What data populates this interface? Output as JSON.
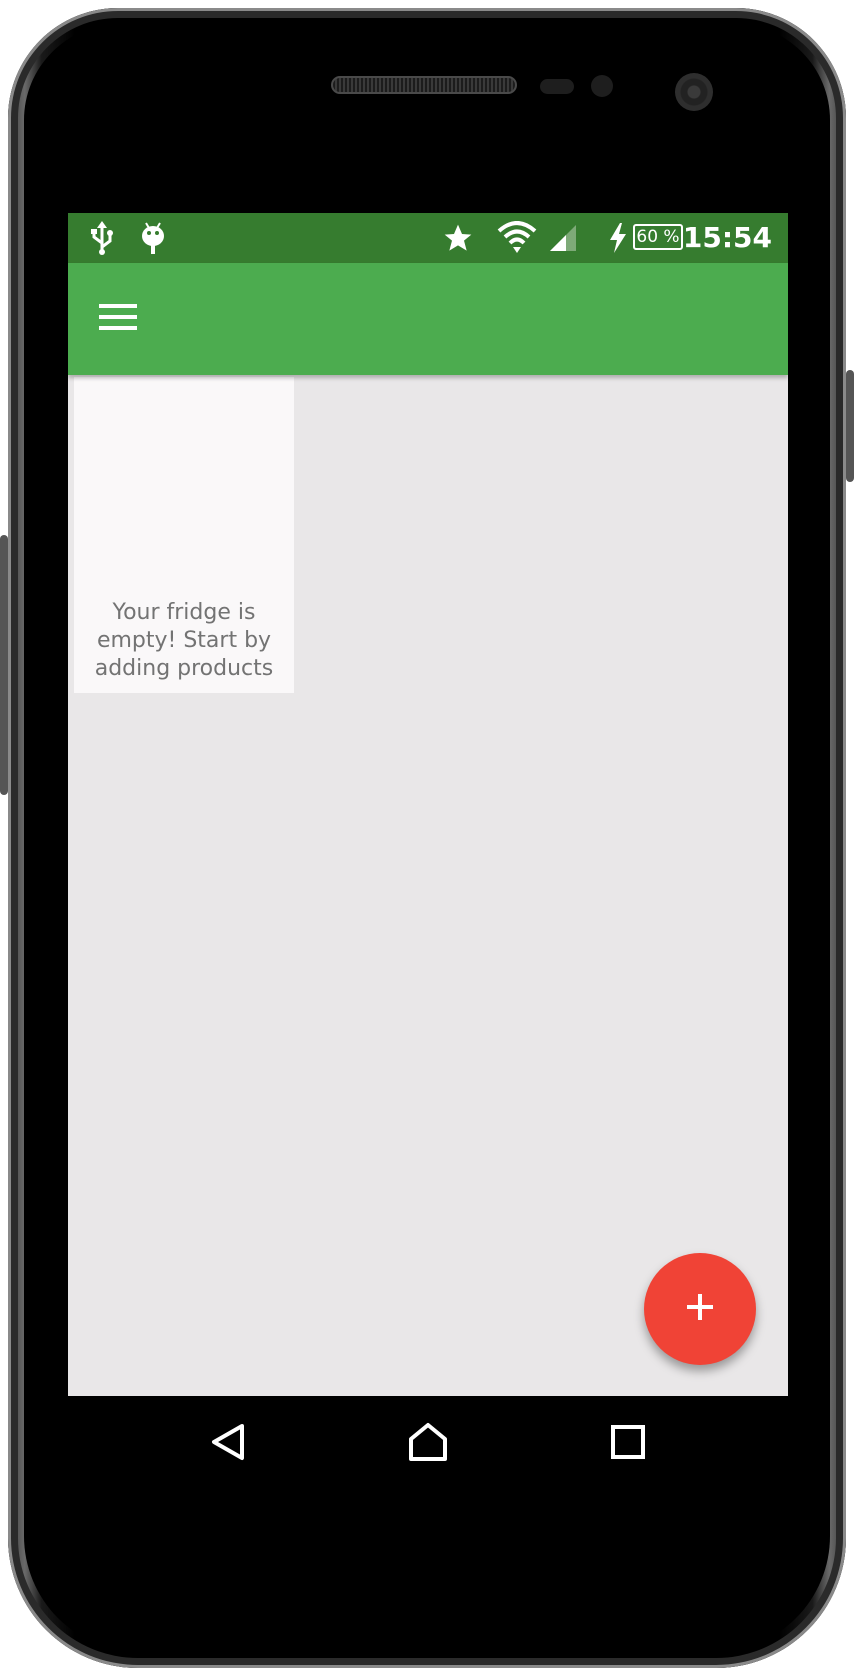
{
  "status_bar": {
    "time": "15:54",
    "battery_level": "60 %",
    "icons": [
      "usb-icon",
      "android-debug-icon",
      "star-icon",
      "wifi-icon",
      "cell-signal-icon",
      "charging-icon",
      "battery-icon"
    ]
  },
  "app_bar": {
    "menu_icon": "hamburger-menu-icon",
    "color": "#4cac4f",
    "status_color": "#367c2f"
  },
  "main": {
    "empty_message": "Your fridge is empty! Start by adding products"
  },
  "fab": {
    "icon": "plus-icon",
    "color": "#f04336"
  },
  "nav_bar": {
    "buttons": [
      "back-icon",
      "home-icon",
      "recents-icon"
    ]
  }
}
